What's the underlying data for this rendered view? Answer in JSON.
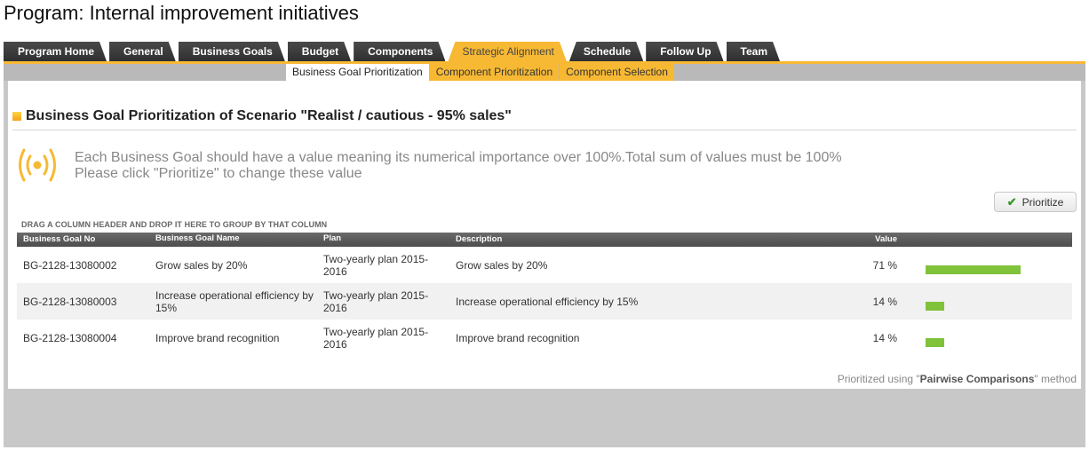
{
  "page_title": "Program: Internal improvement initiatives",
  "tabs": [
    {
      "label": "Program Home",
      "active": false
    },
    {
      "label": "General",
      "active": false
    },
    {
      "label": "Business Goals",
      "active": false
    },
    {
      "label": "Budget",
      "active": false
    },
    {
      "label": "Components",
      "active": false
    },
    {
      "label": "Strategic Alignment",
      "active": true
    },
    {
      "label": "Schedule",
      "active": false
    },
    {
      "label": "Follow Up",
      "active": false
    },
    {
      "label": "Team",
      "active": false
    }
  ],
  "subtabs": [
    {
      "label": "Business Goal Prioritization",
      "active": true
    },
    {
      "label": "Component Prioritization",
      "active": false
    },
    {
      "label": "Component Selection",
      "active": false
    }
  ],
  "section_title": "Business Goal Prioritization of Scenario \"Realist / cautious - 95% sales\"",
  "info": {
    "icon": "broadcast-icon",
    "line1": "Each Business Goal should have a value meaning its numerical importance over 100%.Total sum of values must be 100%",
    "line2": "Please click \"Prioritize\" to change these value"
  },
  "prioritize_button": {
    "label": "Prioritize",
    "icon": "check-icon"
  },
  "grid": {
    "group_hint": "DRAG A COLUMN HEADER AND DROP IT HERE TO GROUP BY THAT COLUMN",
    "columns": [
      "Business Goal No",
      "Business Goal Name",
      "Plan",
      "Description",
      "Value"
    ],
    "rows": [
      {
        "no": "BG-2128-13080002",
        "name": "Grow sales by 20%",
        "plan": "Two-yearly plan 2015-2016",
        "description": "Grow sales by 20%",
        "value": "71 %",
        "percent": 71
      },
      {
        "no": "BG-2128-13080003",
        "name": "Increase operational efficiency by 15%",
        "plan": "Two-yearly plan 2015-2016",
        "description": "Increase operational efficiency by 15%",
        "value": "14 %",
        "percent": 14
      },
      {
        "no": "BG-2128-13080004",
        "name": "Improve brand recognition",
        "plan": "Two-yearly plan 2015-2016",
        "description": "Improve brand recognition",
        "value": "14 %",
        "percent": 14
      }
    ]
  },
  "footer": {
    "prefix": "Prioritized using \"",
    "method": "Pairwise Comparisons",
    "suffix": "\" method"
  },
  "colors": {
    "accent": "#f7b934",
    "bar": "#80c23a",
    "tab_dark": "#3a3a3a"
  }
}
